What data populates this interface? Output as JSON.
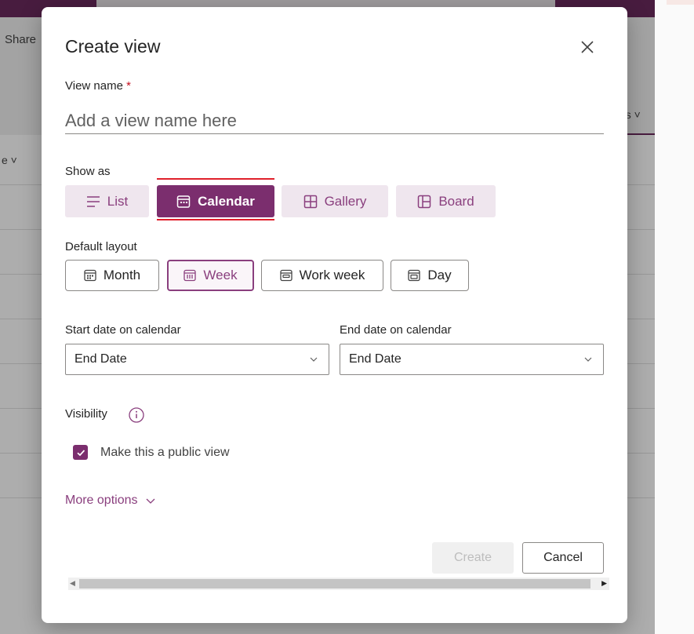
{
  "background": {
    "share_label": "Share",
    "ons_label": "ns ˅",
    "e_label": "e ˅"
  },
  "dialog": {
    "title": "Create view",
    "view_name_label": "View name",
    "required_mark": "*",
    "view_name_placeholder": "Add a view name here",
    "show_as_label": "Show as",
    "show_as_options": [
      {
        "label": "List",
        "icon": "list-icon",
        "selected": false
      },
      {
        "label": "Calendar",
        "icon": "calendar-icon",
        "selected": true
      },
      {
        "label": "Gallery",
        "icon": "gallery-icon",
        "selected": false
      },
      {
        "label": "Board",
        "icon": "board-icon",
        "selected": false
      }
    ],
    "default_layout_label": "Default layout",
    "layout_options": [
      {
        "label": "Month",
        "icon": "month-icon",
        "selected": false
      },
      {
        "label": "Week",
        "icon": "week-icon",
        "selected": true
      },
      {
        "label": "Work week",
        "icon": "work-week-icon",
        "selected": false
      },
      {
        "label": "Day",
        "icon": "day-icon",
        "selected": false
      }
    ],
    "start_date_label": "Start date on calendar",
    "start_date_value": "End Date",
    "end_date_label": "End date on calendar",
    "end_date_value": "End Date",
    "visibility_label": "Visibility",
    "public_view_label": "Make this a public view",
    "public_view_checked": true,
    "more_options_label": "More options",
    "create_label": "Create",
    "cancel_label": "Cancel"
  },
  "colors": {
    "accent": "#7b2e6e",
    "accent_light": "#efe6ee",
    "highlight_red": "#e0202b"
  }
}
